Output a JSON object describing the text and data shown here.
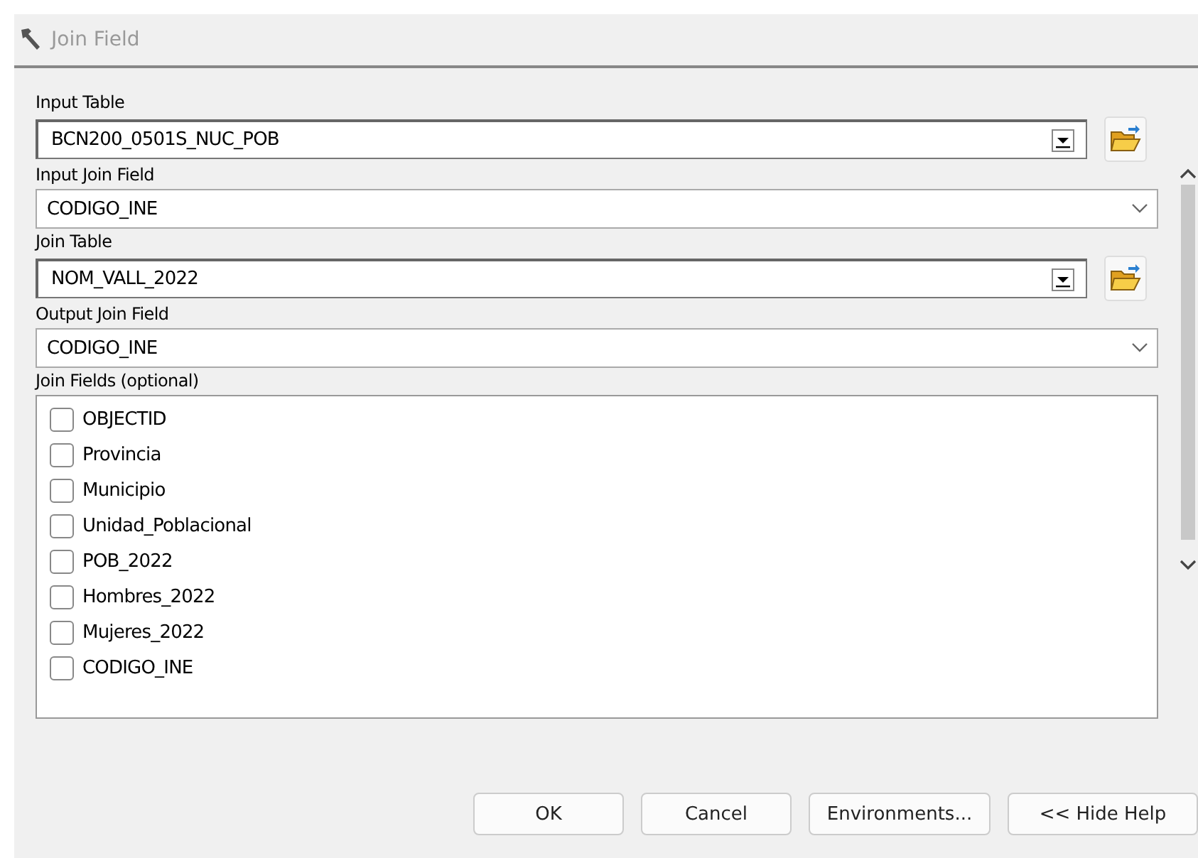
{
  "window": {
    "title": "Join Field"
  },
  "fields": [
    {
      "label": "Input Table",
      "value": "BCN200_0501S_NUC_POB",
      "kind": "table"
    },
    {
      "label": "Input Join Field",
      "value": "CODIGO_INE",
      "kind": "dropdown"
    },
    {
      "label": "Join Table",
      "value": "NOM_VALL_2022",
      "kind": "table"
    },
    {
      "label": "Output Join Field",
      "value": "CODIGO_INE",
      "kind": "dropdown"
    }
  ],
  "join_fields": {
    "label": "Join Fields (optional)",
    "items": [
      {
        "label": "OBJECTID",
        "checked": false
      },
      {
        "label": "Provincia",
        "checked": false
      },
      {
        "label": "Municipio",
        "checked": false
      },
      {
        "label": "Unidad_Poblacional",
        "checked": false
      },
      {
        "label": "POB_2022",
        "checked": false
      },
      {
        "label": "Hombres_2022",
        "checked": false
      },
      {
        "label": "Mujeres_2022",
        "checked": false
      },
      {
        "label": "CODIGO_INE",
        "checked": false
      }
    ]
  },
  "buttons": [
    "OK",
    "Cancel",
    "Environments...",
    "<< Hide Help"
  ]
}
